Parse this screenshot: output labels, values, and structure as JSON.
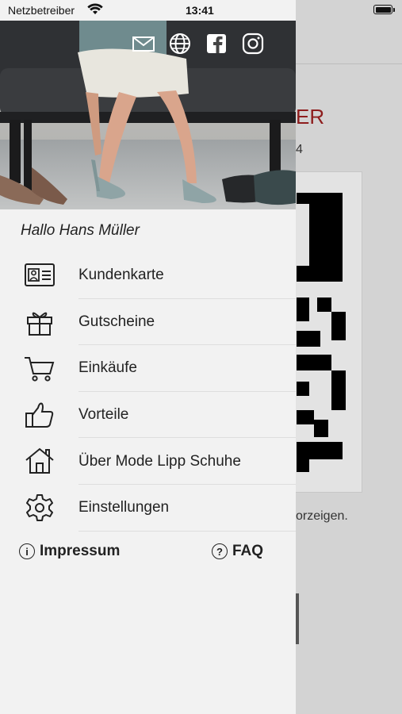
{
  "status_bar": {
    "carrier": "Netzbetreiber",
    "time": "13:41"
  },
  "background": {
    "heading_fragment": "ER",
    "sub_fragment": "4",
    "hint_fragment": "orzeigen."
  },
  "drawer": {
    "social": [
      "mail-icon",
      "globe-icon",
      "facebook-icon",
      "instagram-icon"
    ],
    "greeting": "Hallo Hans Müller",
    "menu": [
      {
        "label": "Kundenkarte",
        "icon": "id-card-icon"
      },
      {
        "label": "Gutscheine",
        "icon": "gift-icon"
      },
      {
        "label": "Einkäufe",
        "icon": "cart-icon"
      },
      {
        "label": "Vorteile",
        "icon": "thumbs-up-icon"
      },
      {
        "label": "Über Mode Lipp Schuhe",
        "icon": "house-icon"
      },
      {
        "label": "Einstellungen",
        "icon": "gear-icon"
      }
    ],
    "footer": {
      "impressum": "Impressum",
      "faq": "FAQ",
      "impressum_icon_glyph": "i",
      "faq_icon_glyph": "?"
    }
  },
  "colors": {
    "drawer_bg": "#f2f2f2",
    "accent_red": "#8e1d1d",
    "overlay": "#d3d3d3"
  }
}
